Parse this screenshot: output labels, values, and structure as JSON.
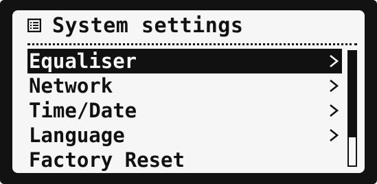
{
  "header": {
    "icon": "list-icon",
    "title": "System settings"
  },
  "menu": {
    "items": [
      {
        "label": "Equaliser",
        "selected": true,
        "has_submenu": true
      },
      {
        "label": "Network",
        "selected": false,
        "has_submenu": true
      },
      {
        "label": "Time/Date",
        "selected": false,
        "has_submenu": true
      },
      {
        "label": "Language",
        "selected": false,
        "has_submenu": true
      },
      {
        "label": "Factory Reset",
        "selected": false,
        "has_submenu": false
      }
    ]
  },
  "scrollbar": {
    "thumb_fraction": 0.75
  },
  "colors": {
    "foreground": "#111111",
    "background": "#f6f6f6",
    "bezel": "#121212"
  }
}
